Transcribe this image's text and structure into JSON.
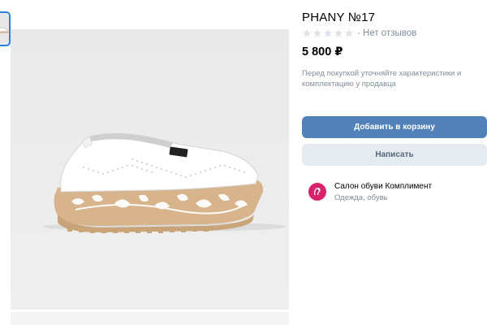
{
  "product": {
    "title": "PHANY №17",
    "rating_stars": 5,
    "rating_value": 0,
    "reviews_text": "· Нет отзывов",
    "price": "5 800 ₽",
    "note": "Перед покупкой уточняйте характеристики и комплектацию у продавца"
  },
  "actions": {
    "add_to_cart_label": "Добавить в корзину",
    "message_label": "Написать"
  },
  "seller": {
    "name": "Салон обуви Комплимент",
    "category": "Одежда, обувь"
  },
  "gallery": {
    "thumbnail_count": 1,
    "selected_index": 0
  },
  "colors": {
    "accent": "#5181b8",
    "secondary_button_bg": "#e5ebf1",
    "secondary_button_text": "#55677d",
    "muted_text": "#818c99",
    "star_empty": "#dfe3e8",
    "avatar_bg": "#d8236c",
    "thumb_border": "#2d81e0"
  },
  "icons": {
    "star": "star-icon",
    "avatar": "seller-avatar-icon"
  }
}
